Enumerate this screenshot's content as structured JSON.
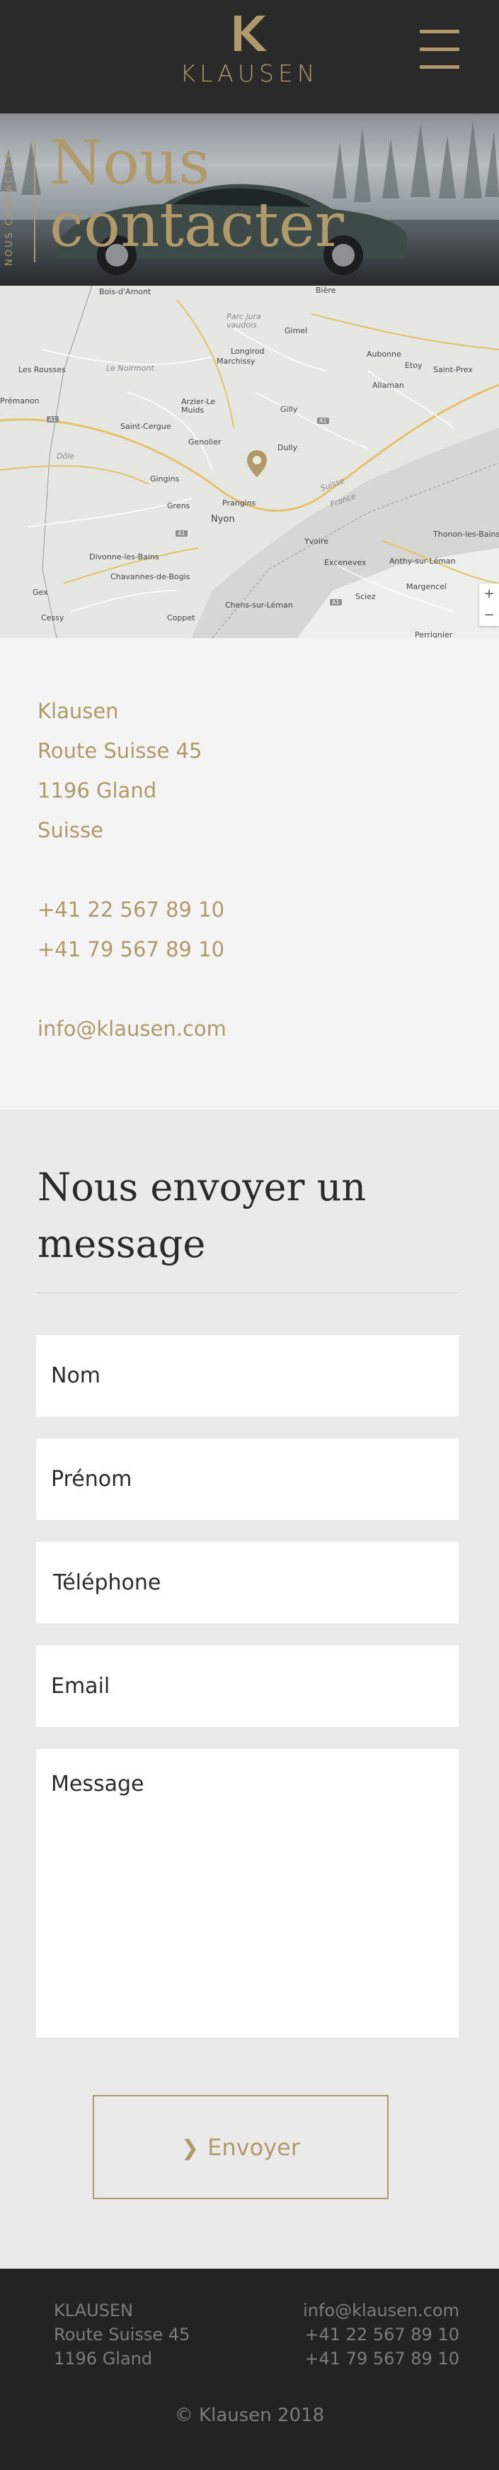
{
  "header": {
    "brand": "KLAUSEN",
    "logo_letter": "K",
    "menu_icon": "hamburger-menu-icon"
  },
  "hero": {
    "vertical_label": "NOUS CONTACTER",
    "title_line1": "Nous",
    "title_line2": "contacter"
  },
  "map": {
    "labels": [
      {
        "text": "Bois-d'Amont",
        "muted": false
      },
      {
        "text": "Bière",
        "muted": false
      },
      {
        "text": "Parc jura vaudois",
        "muted": true
      },
      {
        "text": "Gimel",
        "muted": false
      },
      {
        "text": "Longirod",
        "muted": false
      },
      {
        "text": "Marchissy",
        "muted": false
      },
      {
        "text": "Aubonne",
        "muted": false
      },
      {
        "text": "Etoy",
        "muted": false
      },
      {
        "text": "Saint-Prex",
        "muted": false
      },
      {
        "text": "Allaman",
        "muted": false
      },
      {
        "text": "Les Rousses",
        "muted": false
      },
      {
        "text": "Le Noirmont",
        "muted": true
      },
      {
        "text": "Arzier-Le Muids",
        "muted": false
      },
      {
        "text": "Gilly",
        "muted": false
      },
      {
        "text": "Saint-Cergue",
        "muted": false
      },
      {
        "text": "Genolier",
        "muted": false
      },
      {
        "text": "Dully",
        "muted": false
      },
      {
        "text": "Gingins",
        "muted": false
      },
      {
        "text": "Grens",
        "muted": false
      },
      {
        "text": "Prangins",
        "muted": false
      },
      {
        "text": "Nyon",
        "muted": false
      },
      {
        "text": "Divonne-les-Bains",
        "muted": false
      },
      {
        "text": "Chavannes-de-Bogis",
        "muted": false
      },
      {
        "text": "Gex",
        "muted": false
      },
      {
        "text": "Cessy",
        "muted": false
      },
      {
        "text": "Coppet",
        "muted": false
      },
      {
        "text": "Chens-sur-Léman",
        "muted": false
      },
      {
        "text": "Yvoire",
        "muted": false
      },
      {
        "text": "Excenevex",
        "muted": false
      },
      {
        "text": "Anthy-sur-Léman",
        "muted": false
      },
      {
        "text": "Thonon-les-Bains",
        "muted": false
      },
      {
        "text": "Margencel",
        "muted": false
      },
      {
        "text": "Sciez",
        "muted": false
      },
      {
        "text": "Perrignier",
        "muted": false
      },
      {
        "text": "Dôle",
        "muted": true
      },
      {
        "text": "Prémanon",
        "muted": false
      },
      {
        "text": "Suisse",
        "muted": true
      },
      {
        "text": "France",
        "muted": true
      }
    ],
    "zoom_in": "+",
    "zoom_out": "−"
  },
  "contact": {
    "company": "Klausen",
    "street": "Route Suisse 45",
    "city": "1196 Gland",
    "country": "Suisse",
    "phone1": "+41 22 567 89 10",
    "phone2": "+41 79 567 89 10",
    "email": "info@klausen.com"
  },
  "form": {
    "title_line1": "Nous envoyer un",
    "title_line2": "message",
    "fields": {
      "nom": "Nom",
      "prenom": "Prénom",
      "telephone": "Téléphone",
      "email": "Email",
      "message": "Message"
    },
    "submit_label": "Envoyer"
  },
  "footer": {
    "left_line1": "KLAUSEN",
    "left_line2": "Route Suisse 45",
    "left_line3": "1196 Gland",
    "right_line1": "info@klausen.com",
    "right_line2": "+41 22 567 89 10",
    "right_line3": "+41 79 567 89 10",
    "copyright": "© Klausen 2018"
  },
  "colors": {
    "accent_gold": "#b09a6b",
    "header_bg": "#2a2a2a",
    "footer_bg": "#232323",
    "section_bg": "#eaeaea",
    "address_bg": "#f4f4f4"
  }
}
